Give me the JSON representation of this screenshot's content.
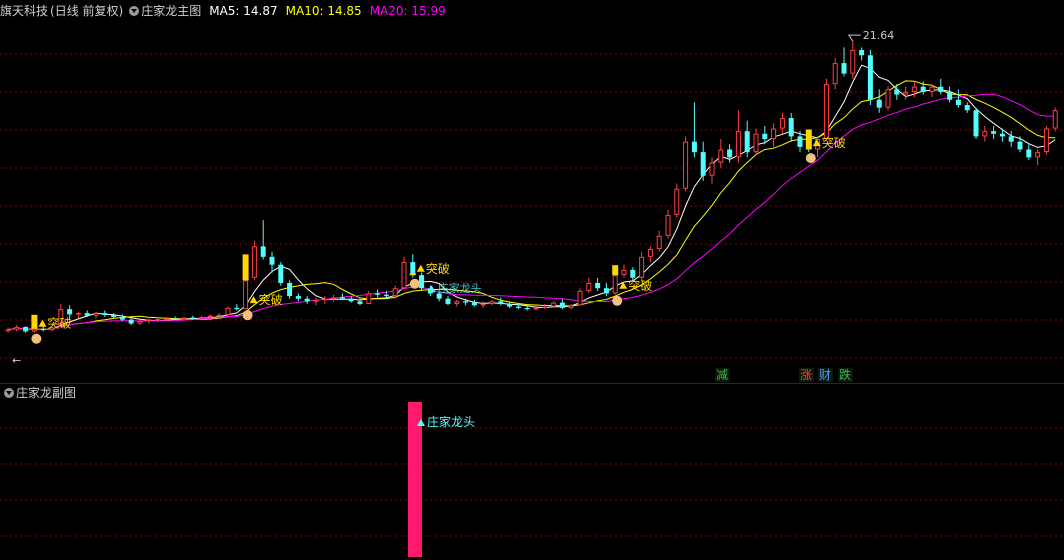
{
  "main_header": {
    "stock_name": "旗天科技",
    "period": "(日线 前复权)",
    "indicator_name": "庄家龙主图",
    "ma5_label": "MA5: 14.87",
    "ma10_label": "MA10: 14.85",
    "ma20_label": "MA20: 15.99"
  },
  "sub_header": {
    "indicator_name": "庄家龙副图"
  },
  "annotations": {
    "high_price": "21.64",
    "breakout": "突破",
    "dragon_head": "庄家龙头",
    "signal_reduce": "减",
    "signal_up": "涨",
    "signal_wealth": "财",
    "signal_down": "跌",
    "left_arrow": "←"
  },
  "colors": {
    "up": "#ff4040",
    "down": "#54fcfc",
    "ma5": "#ffffff",
    "ma10": "#ffff00",
    "ma20": "#ff00ff",
    "grid": "#8b0000",
    "highlight_bar": "#ff1a6e",
    "breakout_bar": "#ffd700"
  },
  "chart_data": {
    "type": "candlestick",
    "y_range": [
      9,
      22.6
    ],
    "highest": 21.64,
    "candles": [
      [
        10.6,
        10.7,
        10.5,
        10.62
      ],
      [
        10.62,
        10.8,
        10.55,
        10.72
      ],
      [
        10.72,
        10.75,
        10.5,
        10.55
      ],
      [
        10.55,
        10.7,
        10.5,
        10.65
      ],
      [
        10.65,
        10.75,
        10.55,
        10.6
      ],
      [
        10.6,
        10.75,
        10.55,
        10.7
      ],
      [
        10.8,
        11.6,
        10.8,
        11.4
      ],
      [
        11.4,
        11.55,
        11.0,
        11.2
      ],
      [
        11.2,
        11.3,
        11.05,
        11.25
      ],
      [
        11.25,
        11.35,
        11.1,
        11.15
      ],
      [
        11.15,
        11.3,
        11.05,
        11.25
      ],
      [
        11.25,
        11.35,
        11.1,
        11.18
      ],
      [
        11.18,
        11.25,
        11.05,
        11.1
      ],
      [
        11.1,
        11.2,
        10.95,
        11.0
      ],
      [
        11.0,
        11.05,
        10.8,
        10.85
      ],
      [
        10.85,
        11.0,
        10.8,
        10.95
      ],
      [
        10.95,
        11.05,
        10.85,
        11.0
      ],
      [
        11.0,
        11.1,
        10.9,
        11.02
      ],
      [
        11.02,
        11.1,
        10.95,
        11.05
      ],
      [
        11.05,
        11.12,
        10.98,
        11.0
      ],
      [
        11.0,
        11.1,
        10.95,
        11.08
      ],
      [
        11.08,
        11.15,
        11.0,
        11.05
      ],
      [
        11.05,
        11.15,
        11.0,
        11.1
      ],
      [
        11.1,
        11.2,
        11.05,
        11.15
      ],
      [
        11.15,
        11.25,
        11.1,
        11.18
      ],
      [
        11.18,
        11.5,
        11.15,
        11.45
      ],
      [
        11.45,
        11.6,
        11.35,
        11.4
      ],
      [
        11.4,
        12.6,
        11.4,
        12.5
      ],
      [
        12.6,
        14.0,
        12.5,
        13.8
      ],
      [
        13.8,
        14.8,
        13.3,
        13.4
      ],
      [
        13.4,
        13.6,
        12.8,
        13.1
      ],
      [
        13.1,
        13.2,
        12.3,
        12.4
      ],
      [
        12.4,
        12.5,
        11.8,
        11.9
      ],
      [
        11.9,
        12.0,
        11.7,
        11.8
      ],
      [
        11.8,
        11.9,
        11.6,
        11.7
      ],
      [
        11.7,
        11.85,
        11.55,
        11.75
      ],
      [
        11.75,
        11.9,
        11.6,
        11.8
      ],
      [
        11.8,
        11.95,
        11.7,
        11.85
      ],
      [
        11.85,
        12.0,
        11.75,
        11.8
      ],
      [
        11.8,
        11.9,
        11.65,
        11.7
      ],
      [
        11.7,
        11.8,
        11.55,
        11.6
      ],
      [
        11.6,
        12.1,
        11.6,
        12.0
      ],
      [
        12.0,
        12.15,
        11.85,
        11.95
      ],
      [
        11.95,
        12.1,
        11.8,
        11.9
      ],
      [
        11.9,
        12.3,
        11.8,
        12.2
      ],
      [
        12.2,
        13.4,
        12.2,
        13.2
      ],
      [
        13.2,
        13.5,
        12.6,
        12.7
      ],
      [
        12.7,
        12.8,
        12.1,
        12.2
      ],
      [
        12.2,
        12.3,
        11.9,
        12.0
      ],
      [
        12.0,
        12.05,
        11.7,
        11.8
      ],
      [
        11.8,
        11.9,
        11.55,
        11.6
      ],
      [
        11.6,
        11.75,
        11.5,
        11.7
      ],
      [
        11.7,
        11.8,
        11.55,
        11.65
      ],
      [
        11.65,
        11.75,
        11.5,
        11.55
      ],
      [
        11.55,
        11.7,
        11.45,
        11.6
      ],
      [
        11.6,
        11.75,
        11.55,
        11.7
      ],
      [
        11.7,
        11.85,
        11.55,
        11.6
      ],
      [
        11.6,
        11.7,
        11.45,
        11.5
      ],
      [
        11.5,
        11.6,
        11.4,
        11.45
      ],
      [
        11.45,
        11.55,
        11.35,
        11.4
      ],
      [
        11.4,
        11.55,
        11.35,
        11.45
      ],
      [
        11.45,
        11.6,
        11.4,
        11.5
      ],
      [
        11.5,
        11.7,
        11.45,
        11.65
      ],
      [
        11.65,
        11.8,
        11.4,
        11.45
      ],
      [
        11.45,
        11.6,
        11.4,
        11.55
      ],
      [
        11.55,
        12.2,
        11.55,
        12.1
      ],
      [
        12.1,
        12.6,
        12.0,
        12.4
      ],
      [
        12.4,
        12.6,
        12.1,
        12.2
      ],
      [
        12.2,
        12.4,
        11.9,
        12.0
      ],
      [
        12.0,
        12.8,
        11.95,
        12.7
      ],
      [
        12.7,
        13.1,
        12.6,
        12.9
      ],
      [
        12.9,
        13.0,
        12.5,
        12.6
      ],
      [
        12.6,
        13.6,
        12.5,
        13.4
      ],
      [
        13.4,
        13.8,
        13.2,
        13.7
      ],
      [
        13.7,
        14.4,
        13.6,
        14.2
      ],
      [
        14.2,
        15.2,
        14.1,
        15.0
      ],
      [
        15.0,
        16.2,
        14.9,
        16.0
      ],
      [
        16.0,
        18.0,
        15.9,
        17.8
      ],
      [
        17.8,
        19.3,
        17.2,
        17.4
      ],
      [
        17.4,
        17.8,
        16.3,
        16.5
      ],
      [
        16.5,
        17.2,
        16.2,
        17.0
      ],
      [
        17.0,
        17.9,
        16.8,
        17.5
      ],
      [
        17.5,
        17.7,
        17.0,
        17.2
      ],
      [
        17.2,
        19.0,
        17.0,
        18.2
      ],
      [
        18.2,
        18.6,
        17.2,
        17.4
      ],
      [
        17.4,
        18.3,
        17.3,
        18.1
      ],
      [
        18.1,
        18.4,
        17.7,
        17.9
      ],
      [
        17.9,
        18.5,
        17.6,
        18.3
      ],
      [
        18.3,
        18.9,
        18.1,
        18.7
      ],
      [
        18.7,
        18.9,
        17.8,
        18.0
      ],
      [
        18.0,
        18.2,
        17.4,
        17.6
      ],
      [
        17.6,
        17.75,
        17.4,
        17.5
      ],
      [
        17.5,
        18.0,
        17.2,
        17.9
      ],
      [
        17.9,
        20.2,
        17.8,
        20.0
      ],
      [
        20.0,
        21.0,
        19.8,
        20.8
      ],
      [
        20.8,
        21.4,
        20.3,
        20.4
      ],
      [
        20.4,
        21.64,
        20.2,
        21.3
      ],
      [
        21.3,
        21.4,
        20.9,
        21.1
      ],
      [
        21.1,
        21.3,
        19.2,
        19.4
      ],
      [
        19.4,
        19.8,
        18.9,
        19.1
      ],
      [
        19.1,
        19.9,
        19.0,
        19.8
      ],
      [
        19.8,
        20.0,
        19.4,
        19.6
      ],
      [
        19.6,
        19.9,
        19.4,
        19.7
      ],
      [
        19.7,
        20.1,
        19.5,
        19.9
      ],
      [
        19.9,
        20.1,
        19.6,
        19.7
      ],
      [
        19.7,
        20.0,
        19.5,
        19.9
      ],
      [
        19.9,
        20.2,
        19.6,
        19.7
      ],
      [
        19.7,
        19.9,
        19.3,
        19.4
      ],
      [
        19.4,
        19.8,
        19.1,
        19.2
      ],
      [
        19.2,
        19.3,
        18.9,
        19.0
      ],
      [
        19.0,
        19.1,
        17.9,
        18.0
      ],
      [
        18.0,
        18.4,
        17.8,
        18.2
      ],
      [
        18.2,
        18.4,
        17.9,
        18.1
      ],
      [
        18.1,
        18.3,
        17.8,
        18.0
      ],
      [
        18.0,
        18.2,
        17.6,
        17.8
      ],
      [
        17.8,
        18.0,
        17.4,
        17.5
      ],
      [
        17.5,
        17.7,
        17.1,
        17.2
      ],
      [
        17.2,
        17.5,
        16.9,
        17.4
      ],
      [
        17.4,
        18.4,
        17.3,
        18.3
      ],
      [
        18.3,
        19.1,
        18.2,
        19.0
      ]
    ]
  }
}
